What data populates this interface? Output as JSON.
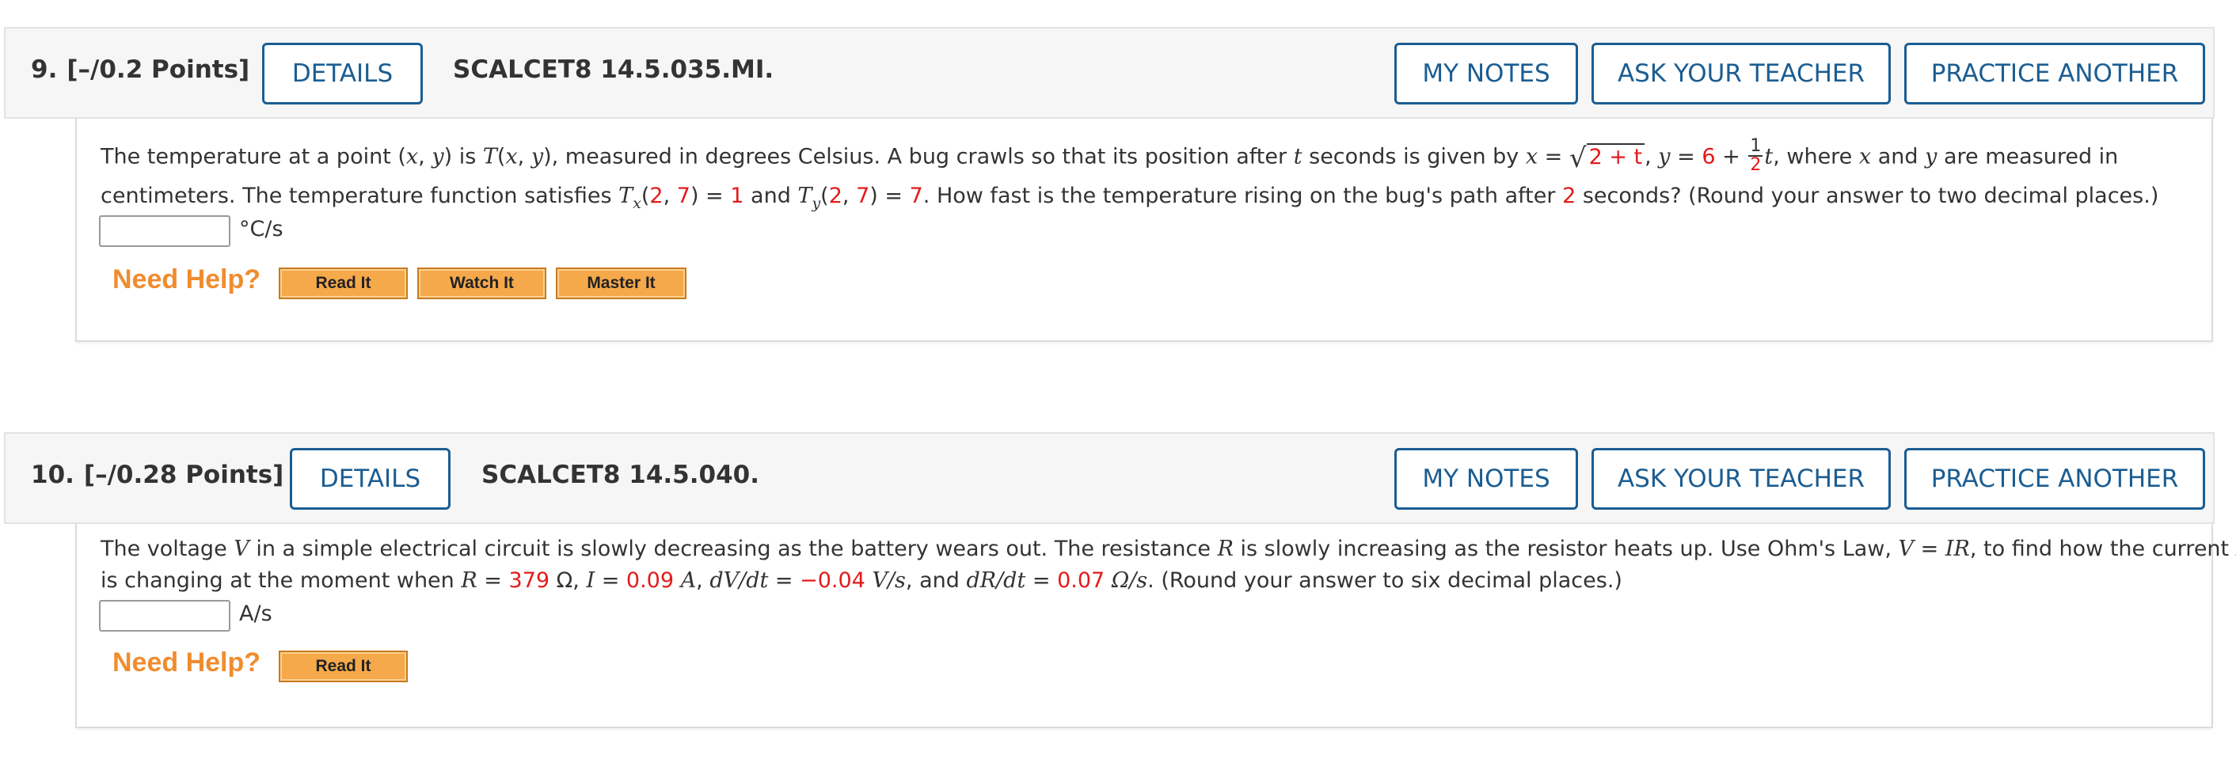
{
  "questions": [
    {
      "number": "9.",
      "points": "[–/0.2 Points]",
      "details_label": "DETAILS",
      "code": "SCALCET8 14.5.035.MI.",
      "my_notes_label": "MY NOTES",
      "ask_teacher_label": "ASK YOUR TEACHER",
      "practice_label": "PRACTICE ANOTHER",
      "text": {
        "a": "The temperature at a point (",
        "x": "x",
        "comma": ", ",
        "y": "y",
        "b": ") is ",
        "T": "T",
        "c": "(",
        "x2": "x",
        "y2": "y",
        "d": "), measured in degrees Celsius. A bug crawls so that its position after ",
        "t": "t",
        "e": " seconds is given by ",
        "x3": "x",
        "eq": " = ",
        "sqrt_sym": "√",
        "radicand": "2 + t",
        "f": ", ",
        "y3": "y",
        "g": " = ",
        "six": "6",
        "plus": " + ",
        "num": "1",
        "den": "2",
        "t2": "t",
        "h": ", where ",
        "x4": "x",
        "and": " and ",
        "y4": "y",
        "i": " are measured in",
        "line2a": "centimeters. The temperature function satisfies ",
        "T2": "T",
        "subx": "x",
        "p1": "(",
        "v2a": "2",
        "v7a": "7",
        "p2": ") = ",
        "one": "1",
        "and2": " and ",
        "T3": "T",
        "suby": "y",
        "v2b": "2",
        "v7b": "7",
        "seven": "7",
        "line2b": ". How fast is the temperature rising on the bug's path after ",
        "two": "2",
        "line2c": " seconds? (Round your answer to two decimal places.)"
      },
      "answer_value": "",
      "unit": "°C/s",
      "need_help": "Need Help?",
      "help_buttons": [
        "Read It",
        "Watch It",
        "Master It"
      ]
    },
    {
      "number": "10.",
      "points": "[–/0.28 Points]",
      "details_label": "DETAILS",
      "code": "SCALCET8 14.5.040.",
      "my_notes_label": "MY NOTES",
      "ask_teacher_label": "ASK YOUR TEACHER",
      "practice_label": "PRACTICE ANOTHER",
      "text": {
        "a": "The voltage ",
        "V": "V",
        "b": " in a simple electrical circuit is slowly decreasing as the battery wears out. The resistance ",
        "R": "R",
        "c": " is slowly increasing as the resistor heats up. Use Ohm's Law, ",
        "V2": "V",
        "eq": " = ",
        "IR": "IR",
        "d": ", to find how the current ",
        "I": "I",
        "line2a": "is changing at the moment when ",
        "R2": "R",
        "e": " = ",
        "r_val": "379",
        "ohm1": " Ω, ",
        "I2": "I",
        "f": " = ",
        "i_val": "0.09",
        "A": " A",
        "g": ", ",
        "dvdt": "dV/dt",
        "h": " = ",
        "dv_val": "−0.04",
        "vs": " V/s",
        "i": ", and ",
        "drdt": "dR/dt",
        "j": " = ",
        "dr_val": "0.07",
        "ohms": " Ω/s",
        "k": ". (Round your answer to six decimal places.)"
      },
      "answer_value": "",
      "unit": "A/s",
      "need_help": "Need Help?",
      "help_buttons": [
        "Read It"
      ]
    }
  ]
}
